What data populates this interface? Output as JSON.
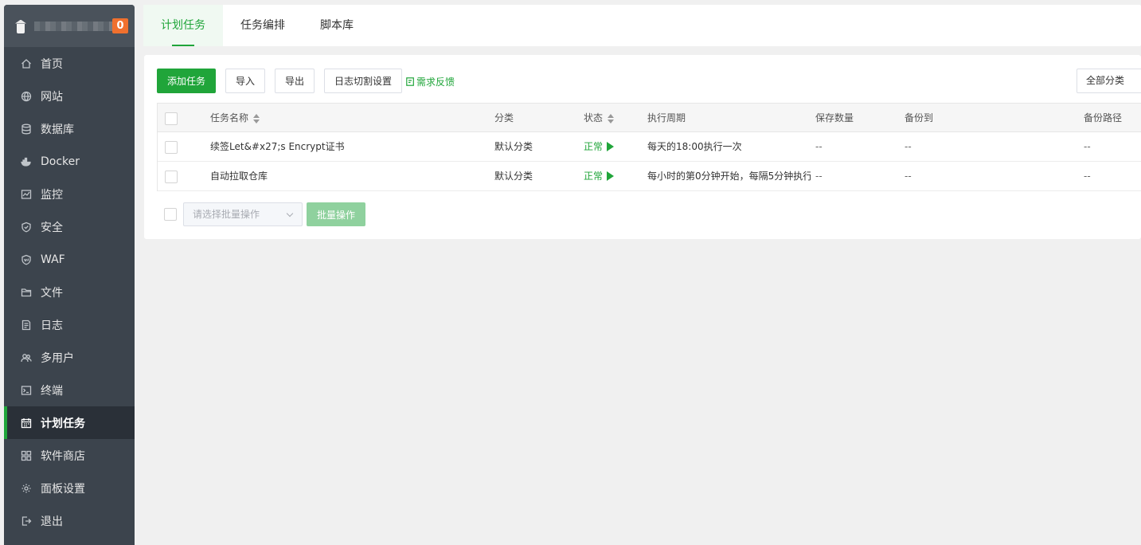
{
  "sidebar": {
    "badge": "0",
    "items": [
      {
        "label": "首页",
        "icon": "home-icon"
      },
      {
        "label": "网站",
        "icon": "globe-icon"
      },
      {
        "label": "数据库",
        "icon": "database-icon"
      },
      {
        "label": "Docker",
        "icon": "docker-icon"
      },
      {
        "label": "监控",
        "icon": "monitor-chart-icon"
      },
      {
        "label": "安全",
        "icon": "shield-icon"
      },
      {
        "label": "WAF",
        "icon": "waf-shield-icon"
      },
      {
        "label": "文件",
        "icon": "folder-icon"
      },
      {
        "label": "日志",
        "icon": "log-icon"
      },
      {
        "label": "多用户",
        "icon": "users-icon"
      },
      {
        "label": "终端",
        "icon": "terminal-icon"
      },
      {
        "label": "计划任务",
        "icon": "calendar-icon",
        "active": true
      },
      {
        "label": "软件商店",
        "icon": "grid-icon"
      },
      {
        "label": "面板设置",
        "icon": "gear-icon"
      },
      {
        "label": "退出",
        "icon": "logout-icon"
      }
    ]
  },
  "tabs": [
    "计划任务",
    "任务编排",
    "脚本库"
  ],
  "toolbar": {
    "add": "添加任务",
    "import": "导入",
    "export": "导出",
    "log_split": "日志切割设置",
    "feedback": "需求反馈",
    "category": "全部分类"
  },
  "table": {
    "headers": {
      "name": "任务名称",
      "category": "分类",
      "status": "状态",
      "cycle": "执行周期",
      "save_count": "保存数量",
      "backup_to": "备份到",
      "backup_path": "备份路径"
    },
    "rows": [
      {
        "name": "续签Let&#x27;s Encrypt证书",
        "category": "默认分类",
        "status": "正常",
        "cycle": "每天的18:00执行一次",
        "save_count": "--",
        "backup_to": "--",
        "backup_path": "--"
      },
      {
        "name": "自动拉取仓库",
        "category": "默认分类",
        "status": "正常",
        "cycle": "每小时的第0分钟开始，每隔5分钟执行",
        "save_count": "--",
        "backup_to": "--",
        "backup_path": "--"
      }
    ]
  },
  "batch": {
    "placeholder": "请选择批量操作",
    "button": "批量操作"
  },
  "colors": {
    "accent": "#20a53a",
    "sidebar_bg": "#3c444d",
    "badge": "#f0702e"
  }
}
